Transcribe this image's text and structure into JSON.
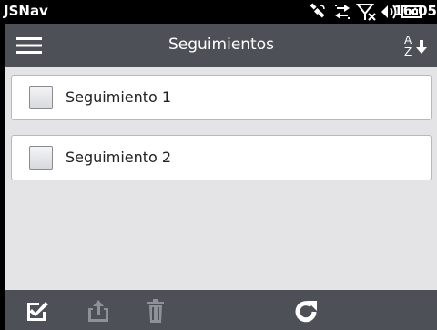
{
  "status_bar": {
    "app_title": "JSNav",
    "time": "16:05",
    "icons": [
      "satellite-icon",
      "data-sync-icon",
      "signal-off-icon",
      "volume-icon",
      "battery-icon"
    ]
  },
  "header": {
    "title": "Seguimientos",
    "menu_icon": "hamburger-icon",
    "sort_icon": "sort-az-icon",
    "sort_letters": {
      "top": "A",
      "bottom": "Z"
    }
  },
  "list": {
    "items": [
      {
        "label": "Seguimiento 1",
        "checked": false
      },
      {
        "label": "Seguimiento 2",
        "checked": false
      }
    ]
  },
  "toolbar": {
    "buttons": [
      {
        "icon": "check-all-icon",
        "enabled": true
      },
      {
        "icon": "upload-icon",
        "enabled": false
      },
      {
        "icon": "trash-icon",
        "enabled": false
      },
      {
        "icon": "refresh-icon",
        "enabled": true
      }
    ]
  },
  "colors": {
    "header_bg": "#4d5157",
    "content_bg": "#e4e4e7",
    "disabled_icon": "#8e9197",
    "enabled_icon": "#ffffff"
  }
}
